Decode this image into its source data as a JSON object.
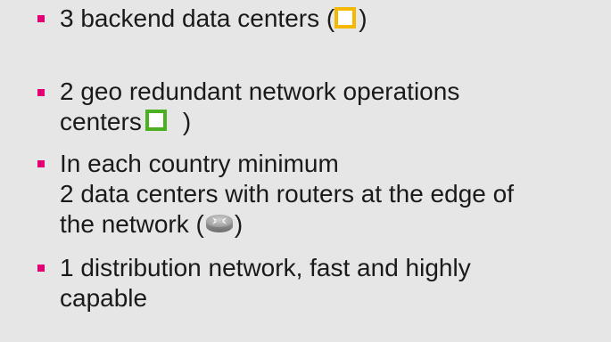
{
  "bullets": [
    {
      "lines": [
        "3 backend data centers (",
        ")"
      ],
      "icon": "yellow-square-icon"
    },
    {
      "lines": [
        "2 geo redundant network operations",
        "centers",
        ")"
      ],
      "icon": "green-square-icon"
    },
    {
      "lines": [
        "In each country minimum",
        "2 data centers with routers at the edge of",
        "the network (",
        ")"
      ],
      "icon": "router-icon"
    },
    {
      "lines": [
        "1 distribution network, fast and highly",
        "capable"
      ]
    }
  ],
  "colors": {
    "background": "#e6e6e6",
    "bullet_marker": "#e20074",
    "text": "#1a1a1a",
    "yellow_icon": "#f5b800",
    "green_icon": "#4caf1f"
  }
}
